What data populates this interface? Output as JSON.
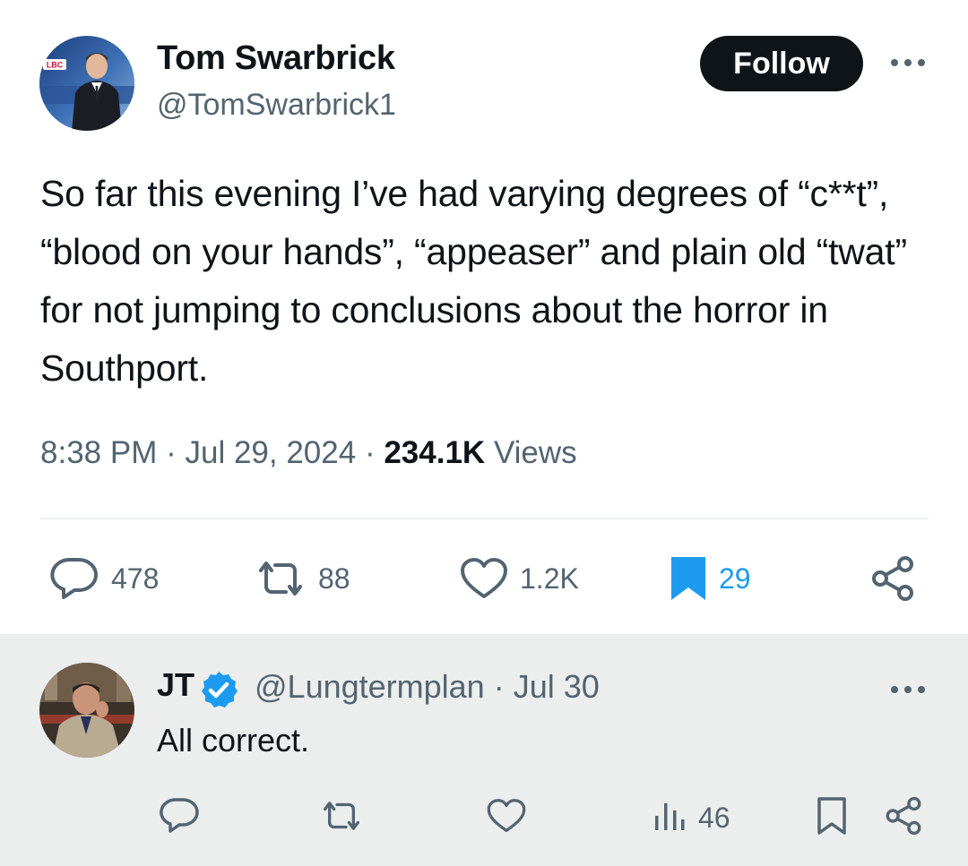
{
  "tweet": {
    "author_name": "Tom Swarbrick",
    "author_handle": "@TomSwarbrick1",
    "follow_label": "Follow",
    "text": "So far this evening I’ve had varying degrees of “c**t”, “blood on your hands”, “appeaser” and plain old “twat” for not jumping to conclusions about the horror in Southport.",
    "time": "8:38 PM",
    "date": "Jul 29, 2024",
    "views_count": "234.1K",
    "views_label": "Views",
    "separator": "·",
    "avatar_badge": "LBC",
    "stats": {
      "replies": "478",
      "reposts": "88",
      "likes": "1.2K",
      "bookmarks": "29"
    }
  },
  "reply": {
    "author_name": "JT",
    "author_handle": "@Lungtermplan",
    "date": "Jul 30",
    "text": "All correct.",
    "views": "46"
  },
  "colors": {
    "text_primary": "#0f1419",
    "text_secondary": "#536471",
    "accent_blue": "#1d9bf0",
    "reply_background": "#eceded"
  },
  "icons": {
    "reply": "speech-bubble-icon",
    "repost": "repost-arrows-icon",
    "like": "heart-icon",
    "bookmark": "bookmark-icon",
    "share": "share-icon",
    "more": "more-dots-icon",
    "verified": "verified-badge-icon",
    "views": "bar-chart-icon"
  }
}
